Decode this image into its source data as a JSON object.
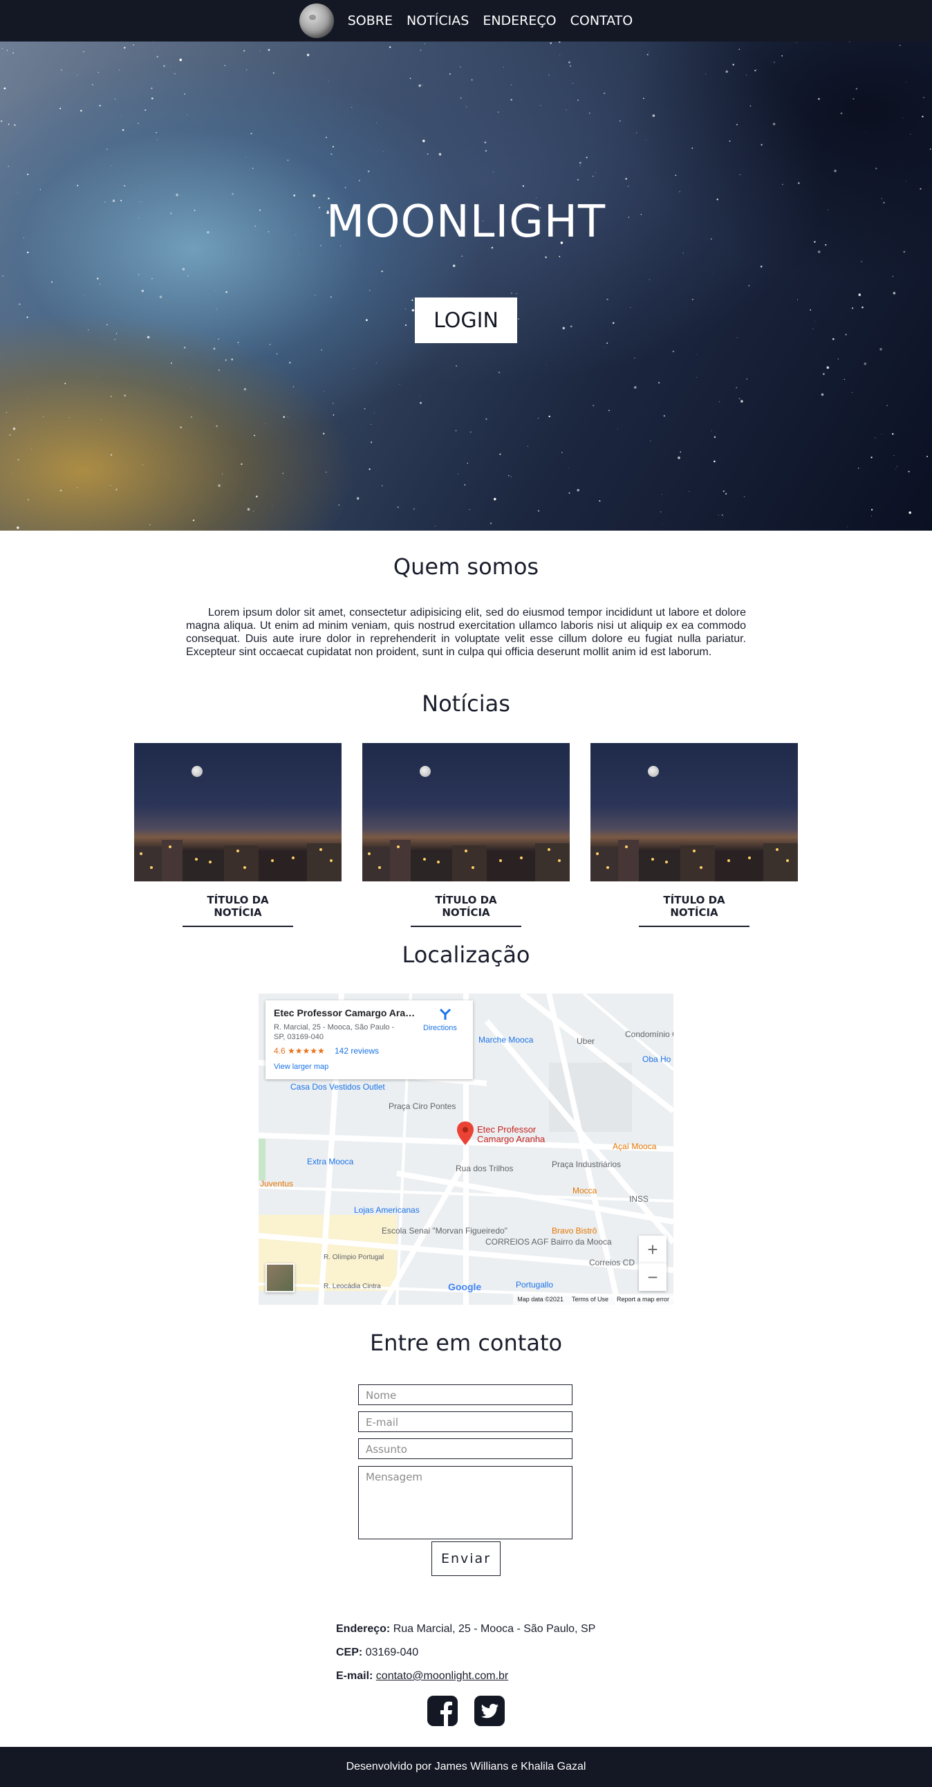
{
  "nav": {
    "logo_icon": "moon-logo-icon",
    "links": [
      "SOBRE",
      "NOTÍCIAS",
      "ENDEREÇO",
      "CONTATO"
    ]
  },
  "hero": {
    "title": "MOONLIGHT",
    "login_label": "LOGIN"
  },
  "about": {
    "title": "Quem somos",
    "text": "Lorem ipsum dolor sit amet, consectetur adipisicing elit, sed do eiusmod tempor incididunt ut labore et dolore magna aliqua. Ut enim ad minim veniam, quis nostrud exercitation ullamco laboris nisi ut aliquip ex ea commodo consequat. Duis aute irure dolor in reprehenderit in voluptate velit esse cillum dolore eu fugiat nulla pariatur. Excepteur sint occaecat cupidatat non proident, sunt in culpa qui officia deserunt mollit anim id est laborum."
  },
  "news": {
    "title": "Notícias",
    "items": [
      {
        "title": "TÍTULO DA NOTÍCIA"
      },
      {
        "title": "TÍTULO DA NOTÍCIA"
      },
      {
        "title": "TÍTULO DA NOTÍCIA"
      }
    ]
  },
  "location": {
    "title": "Localização",
    "place_name": "Etec Professor Camargo Aran...",
    "place_address": "R. Marcial, 25 - Mooca, São Paulo - SP, 03169-040",
    "rating": "4.6 ★★★★★",
    "reviews": "142 reviews",
    "directions": "Directions",
    "larger_map": "View larger map",
    "marker_label": "Etec Professor Camargo Aranha",
    "labels": [
      "Marche Mooca",
      "Uber",
      "Condomínio Central Park",
      "Oba Ho",
      "Casa Dos Vestidos Outlet",
      "Praça Ciro Pontes",
      "Rua dos Trilhos",
      "Açaí Mooca",
      "Praça Industriários",
      "Extra Mooca",
      "Juventus",
      "Mocca",
      "INSS",
      "Lojas Americanas",
      "Escola Senai \"Morvan Figueiredo\"",
      "CORREIOS AGF Bairro da Mooca",
      "Bravo Bistrô",
      "Correios CD",
      "Portugallo",
      "R. Olímpio Portugal",
      "R. Leocádia Cintra",
      "Google"
    ],
    "zoom_in": "+",
    "zoom_out": "−",
    "map_data": "Map data ©2021",
    "terms": "Terms of Use",
    "report": "Report a map error"
  },
  "contact": {
    "title": "Entre em contato",
    "name_placeholder": "Nome",
    "email_placeholder": "E-mail",
    "subject_placeholder": "Assunto",
    "message_placeholder": "Mensagem",
    "send_label": "Enviar"
  },
  "info": {
    "address_label": "Endereço:",
    "address_value": "Rua Marcial, 25 - Mooca - São Paulo, SP",
    "cep_label": "CEP:",
    "cep_value": "03169-040",
    "email_label": "E-mail:",
    "email_value": "contato@moonlight.com.br"
  },
  "social": [
    "facebook-icon",
    "twitter-icon"
  ],
  "footer": {
    "text": "Desenvolvido por James Willians e Khalila Gazal"
  }
}
